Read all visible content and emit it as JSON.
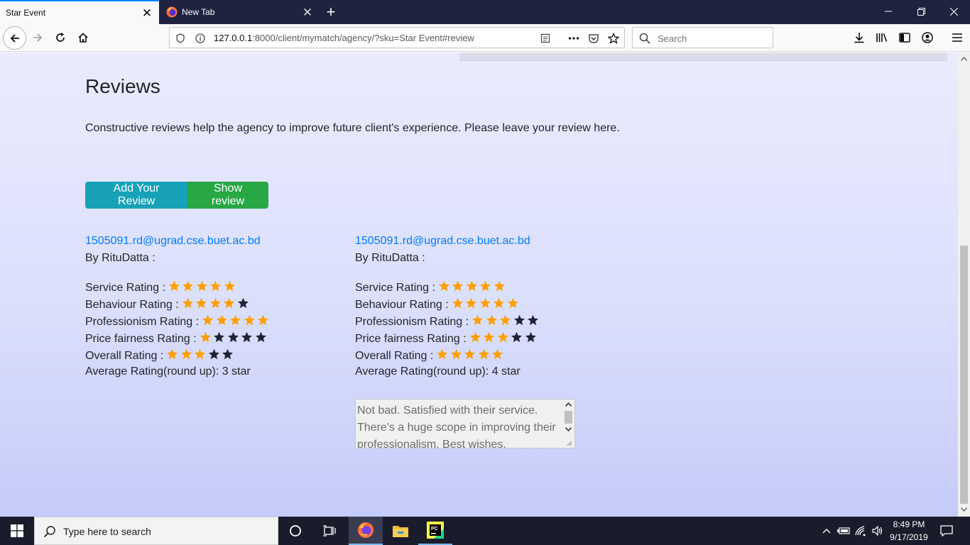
{
  "browser": {
    "tabs": [
      {
        "title": "Star Event",
        "active": true
      },
      {
        "title": "New Tab",
        "active": false
      }
    ],
    "url": {
      "host": "127.0.0.1",
      "rest": ":8000/client/mymatch/agency/?sku=Star Event#review"
    },
    "search_placeholder": "Search"
  },
  "page": {
    "heading": "Reviews",
    "intro": "Constructive reviews help the agency to improve future client's experience. Please leave your review here.",
    "buttons": {
      "add_review": "Add Your Review",
      "show_review": "Show review"
    },
    "reviews": [
      {
        "email": "1505091.rd@ugrad.cse.buet.ac.bd",
        "author": "By RituDatta :",
        "ratings": [
          {
            "label": "Service Rating :",
            "stars": 5
          },
          {
            "label": "Behaviour Rating :",
            "stars": 4
          },
          {
            "label": "Professionism Rating :",
            "stars": 5
          },
          {
            "label": "Price fairness Rating :",
            "stars": 1
          },
          {
            "label": "Overall Rating :",
            "stars": 3
          }
        ],
        "average": "Average Rating(round up): 3 star",
        "comment": null
      },
      {
        "email": "1505091.rd@ugrad.cse.buet.ac.bd",
        "author": "By RituDatta :",
        "ratings": [
          {
            "label": "Service Rating :",
            "stars": 5
          },
          {
            "label": "Behaviour Rating :",
            "stars": 5
          },
          {
            "label": "Professionism Rating :",
            "stars": 3
          },
          {
            "label": "Price fairness Rating :",
            "stars": 3
          },
          {
            "label": "Overall Rating :",
            "stars": 5
          }
        ],
        "average": "Average Rating(round up): 4 star",
        "comment": "Not bad. Satisfied with their service. There's a huge scope in improving their professionalism. Best wishes."
      }
    ],
    "star_colors": {
      "on": "#ff9f00",
      "off": "#1e2433"
    }
  },
  "taskbar": {
    "search_placeholder": "Type here to search",
    "time": "8:49 PM",
    "date": "9/17/2019"
  }
}
